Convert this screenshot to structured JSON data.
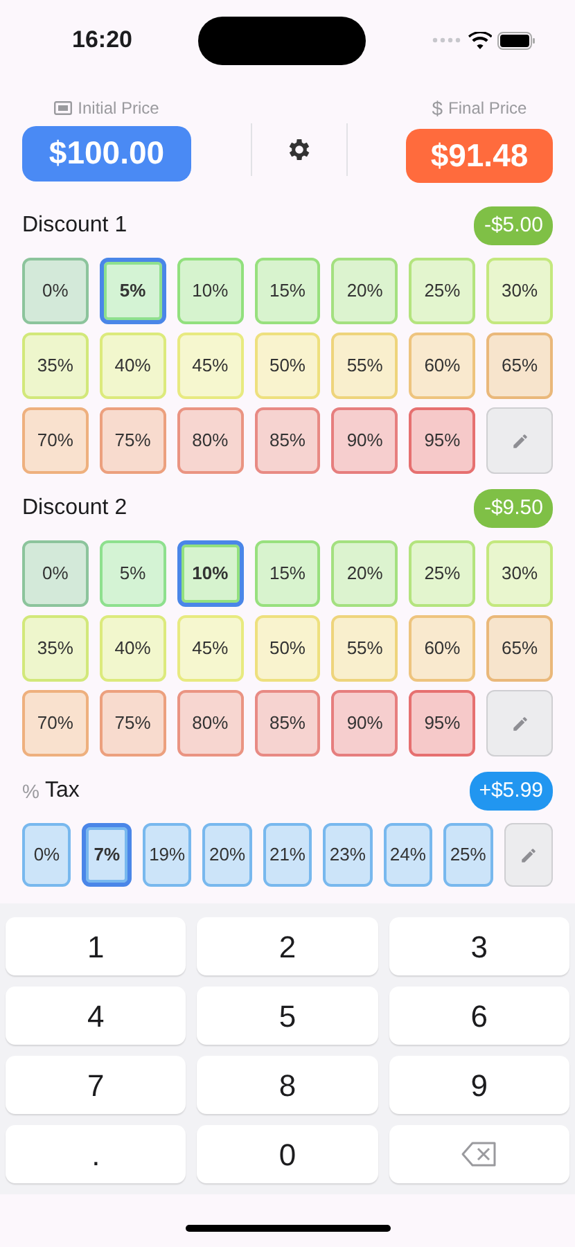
{
  "status_bar": {
    "time": "16:20"
  },
  "header": {
    "initial": {
      "label": "Initial Price",
      "value": "$100.00"
    },
    "final": {
      "label": "Final Price",
      "symbol": "$",
      "value": "$91.48"
    }
  },
  "sections": [
    {
      "kind": "discount",
      "title": "Discount 1",
      "amount": "-$5.00",
      "color": "#7fc046",
      "options": [
        {
          "label": "0%",
          "color": "#8cc49c",
          "selected": false
        },
        {
          "label": "5%",
          "color": "#8ee08e",
          "selected": true
        },
        {
          "label": "10%",
          "color": "#92e07e",
          "selected": false
        },
        {
          "label": "15%",
          "color": "#98e07e",
          "selected": false
        },
        {
          "label": "20%",
          "color": "#a4e080",
          "selected": false
        },
        {
          "label": "25%",
          "color": "#b4e47e",
          "selected": false
        },
        {
          "label": "30%",
          "color": "#c4e87e",
          "selected": false
        },
        {
          "label": "35%",
          "color": "#d2e87a",
          "selected": false
        },
        {
          "label": "40%",
          "color": "#dcea7c",
          "selected": false
        },
        {
          "label": "45%",
          "color": "#e8ea80",
          "selected": false
        },
        {
          "label": "50%",
          "color": "#eee07e",
          "selected": false
        },
        {
          "label": "55%",
          "color": "#eed47c",
          "selected": false
        },
        {
          "label": "60%",
          "color": "#eec47e",
          "selected": false
        },
        {
          "label": "65%",
          "color": "#eab87a",
          "selected": false
        },
        {
          "label": "70%",
          "color": "#eeb07e",
          "selected": false
        },
        {
          "label": "75%",
          "color": "#eca07e",
          "selected": false
        },
        {
          "label": "80%",
          "color": "#ea9482",
          "selected": false
        },
        {
          "label": "85%",
          "color": "#e88a84",
          "selected": false
        },
        {
          "label": "90%",
          "color": "#e67e7e",
          "selected": false
        },
        {
          "label": "95%",
          "color": "#e67070",
          "selected": false
        }
      ]
    },
    {
      "kind": "discount",
      "title": "Discount 2",
      "amount": "-$9.50",
      "color": "#7fc046",
      "options": [
        {
          "label": "0%",
          "color": "#8cc49c",
          "selected": false
        },
        {
          "label": "5%",
          "color": "#8ee08e",
          "selected": false
        },
        {
          "label": "10%",
          "color": "#92e07e",
          "selected": true
        },
        {
          "label": "15%",
          "color": "#98e07e",
          "selected": false
        },
        {
          "label": "20%",
          "color": "#a4e080",
          "selected": false
        },
        {
          "label": "25%",
          "color": "#b4e47e",
          "selected": false
        },
        {
          "label": "30%",
          "color": "#c4e87e",
          "selected": false
        },
        {
          "label": "35%",
          "color": "#d2e87a",
          "selected": false
        },
        {
          "label": "40%",
          "color": "#dcea7c",
          "selected": false
        },
        {
          "label": "45%",
          "color": "#e8ea80",
          "selected": false
        },
        {
          "label": "50%",
          "color": "#eee07e",
          "selected": false
        },
        {
          "label": "55%",
          "color": "#eed47c",
          "selected": false
        },
        {
          "label": "60%",
          "color": "#eec47e",
          "selected": false
        },
        {
          "label": "65%",
          "color": "#eab87a",
          "selected": false
        },
        {
          "label": "70%",
          "color": "#eeb07e",
          "selected": false
        },
        {
          "label": "75%",
          "color": "#eca07e",
          "selected": false
        },
        {
          "label": "80%",
          "color": "#ea9482",
          "selected": false
        },
        {
          "label": "85%",
          "color": "#e88a84",
          "selected": false
        },
        {
          "label": "90%",
          "color": "#e67e7e",
          "selected": false
        },
        {
          "label": "95%",
          "color": "#e67070",
          "selected": false
        }
      ]
    },
    {
      "kind": "tax",
      "prefix": "%",
      "title": "Tax",
      "amount": "+$5.99",
      "color": "#2196f0",
      "options": [
        {
          "label": "0%",
          "color": "#78b8ee",
          "selected": false
        },
        {
          "label": "7%",
          "color": "#78b8ee",
          "selected": true
        },
        {
          "label": "19%",
          "color": "#78b8ee",
          "selected": false
        },
        {
          "label": "20%",
          "color": "#78b8ee",
          "selected": false
        },
        {
          "label": "21%",
          "color": "#78b8ee",
          "selected": false
        },
        {
          "label": "23%",
          "color": "#78b8ee",
          "selected": false
        },
        {
          "label": "24%",
          "color": "#78b8ee",
          "selected": false
        },
        {
          "label": "25%",
          "color": "#78b8ee",
          "selected": false
        }
      ]
    }
  ],
  "keypad": [
    {
      "kind": "digit",
      "label": "1"
    },
    {
      "kind": "digit",
      "label": "2"
    },
    {
      "kind": "digit",
      "label": "3"
    },
    {
      "kind": "digit",
      "label": "4"
    },
    {
      "kind": "digit",
      "label": "5"
    },
    {
      "kind": "digit",
      "label": "6"
    },
    {
      "kind": "digit",
      "label": "7"
    },
    {
      "kind": "digit",
      "label": "8"
    },
    {
      "kind": "digit",
      "label": "9"
    },
    {
      "kind": "digit",
      "label": "."
    },
    {
      "kind": "digit",
      "label": "0"
    },
    {
      "kind": "backspace"
    }
  ]
}
